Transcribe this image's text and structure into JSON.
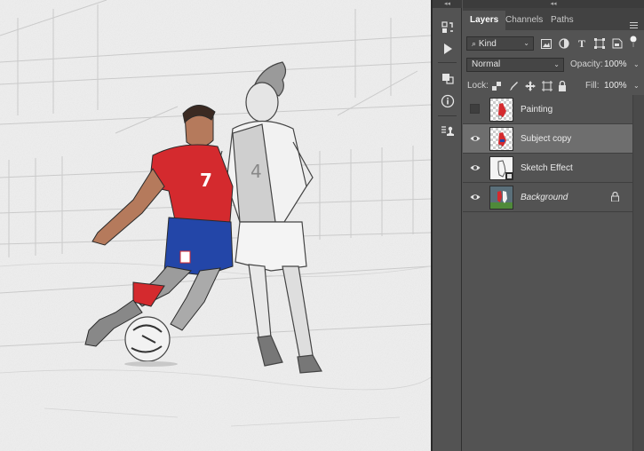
{
  "panel": {
    "tabs": [
      {
        "label": "Layers",
        "active": true
      },
      {
        "label": "Channels",
        "active": false
      },
      {
        "label": "Paths",
        "active": false
      }
    ],
    "filter": {
      "label": "Kind"
    },
    "blend_mode": {
      "value": "Normal"
    },
    "opacity": {
      "label": "Opacity:",
      "value": "100%"
    },
    "lock": {
      "label": "Lock:"
    },
    "fill": {
      "label": "Fill:",
      "value": "100%"
    },
    "layers": [
      {
        "name": "Painting",
        "visible": false,
        "selected": false,
        "locked": false
      },
      {
        "name": "Subject copy",
        "visible": true,
        "selected": true,
        "locked": false
      },
      {
        "name": "Sketch Effect",
        "visible": true,
        "selected": false,
        "locked": false
      },
      {
        "name": "Background",
        "visible": true,
        "selected": false,
        "locked": true
      }
    ]
  },
  "canvas": {
    "jersey_left_number": "7",
    "jersey_right_number": "4"
  },
  "colors": {
    "panel_bg": "#535353",
    "tabbar_bg": "#424242",
    "selected_row": "#6e6e6e",
    "jersey_red": "#d42a2e",
    "shorts_blue": "#2346a8"
  },
  "icons": [
    "history-icon",
    "play-action-icon",
    "3d-icon",
    "info-icon",
    "clone-source-icon",
    "search-icon",
    "image-filter-icon",
    "adjustment-filter-icon",
    "type-filter-icon",
    "shape-filter-icon",
    "smart-object-filter-icon",
    "filter-toggle-icon",
    "lock-transparent-icon",
    "lock-brush-icon",
    "lock-position-icon",
    "lock-artboard-icon",
    "lock-all-icon",
    "eye-icon",
    "lock-icon",
    "panel-menu-icon"
  ]
}
